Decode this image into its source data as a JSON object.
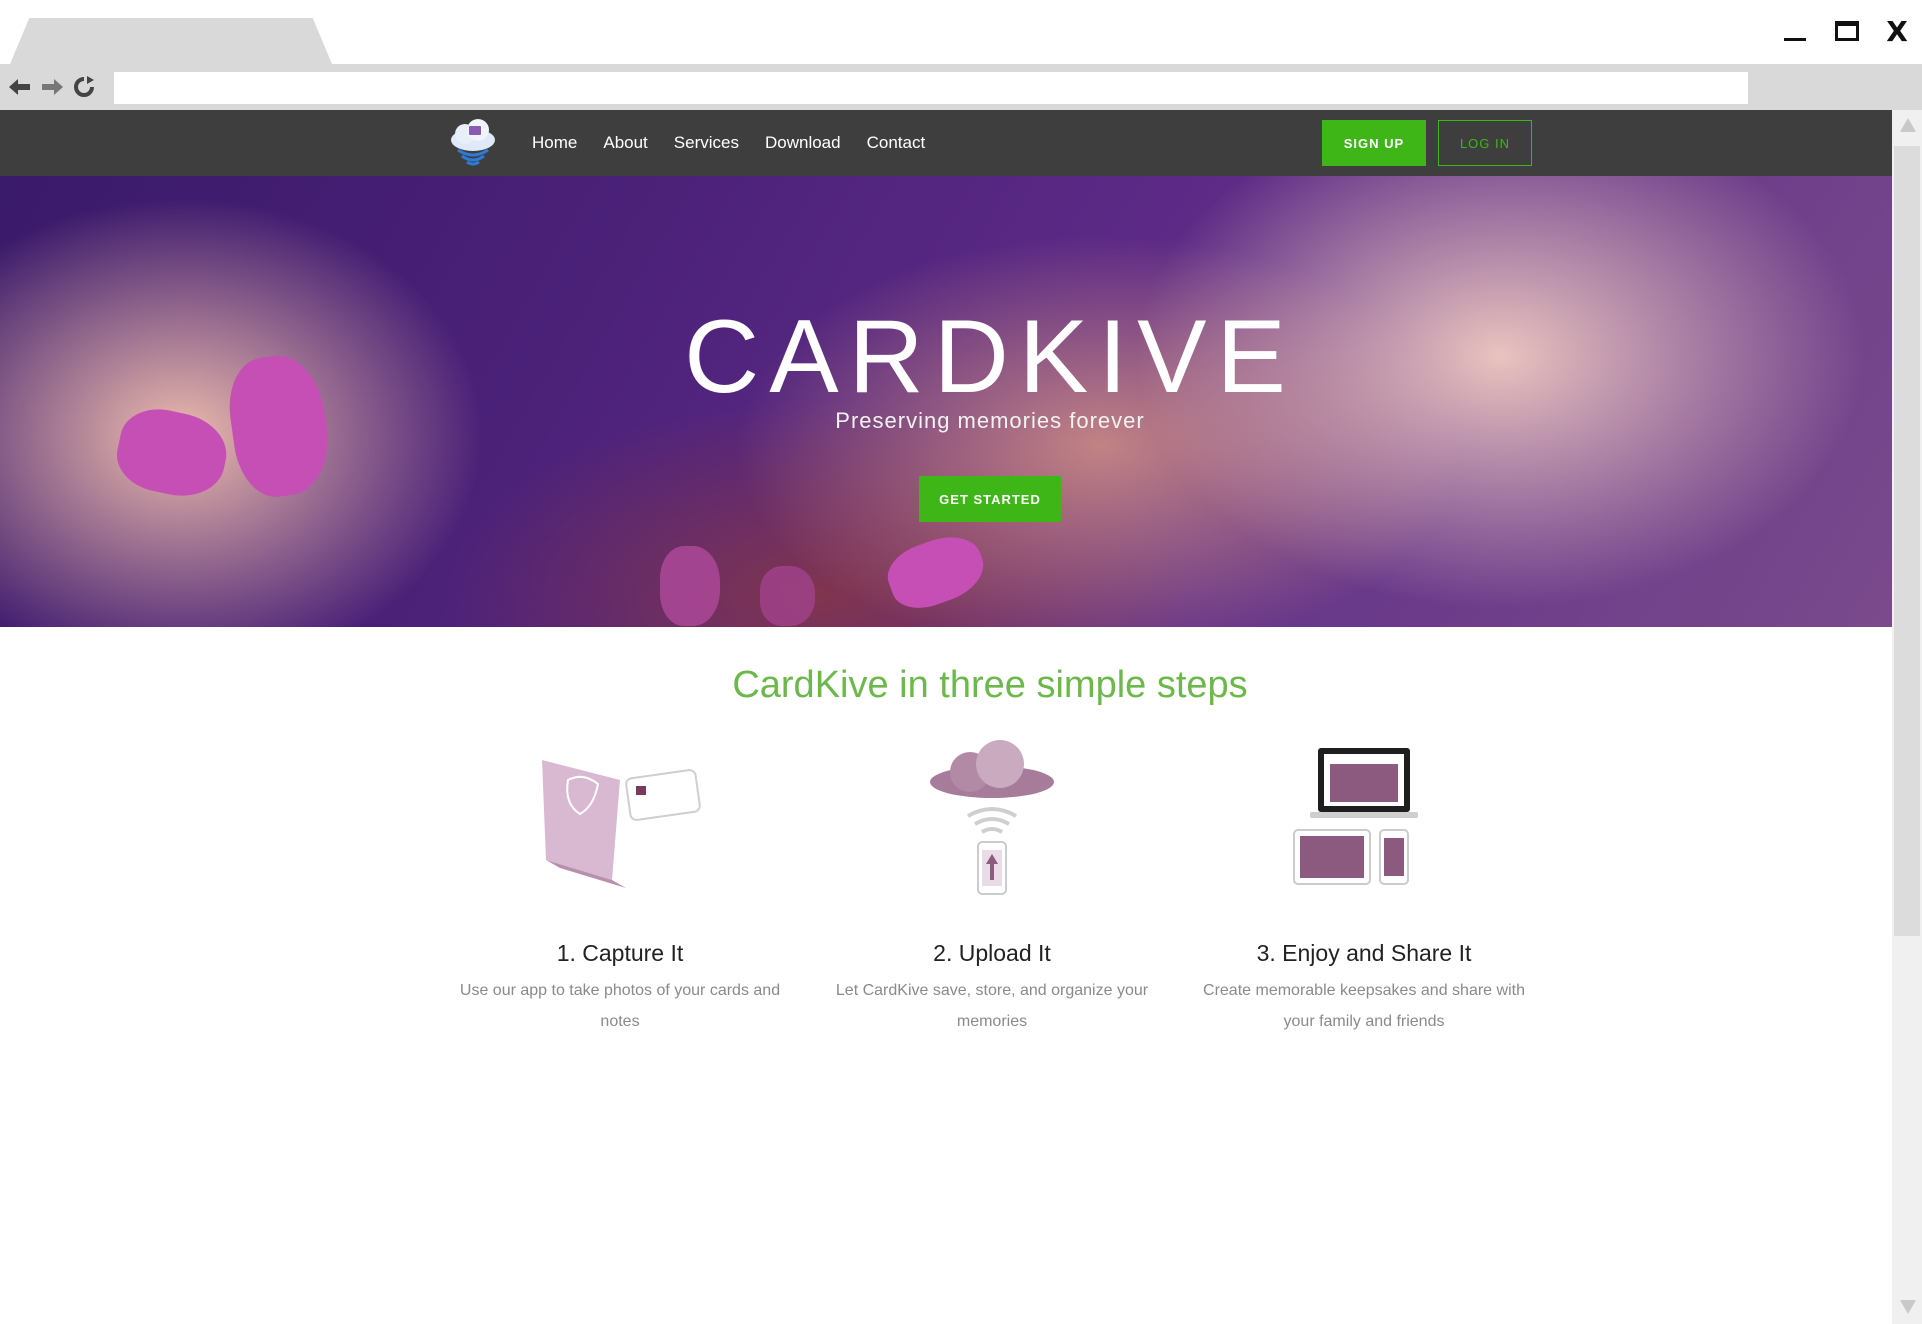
{
  "browser": {
    "address_value": "",
    "icons": [
      "back-arrow-icon",
      "forward-arrow-icon",
      "reload-icon",
      "minimize-icon",
      "maximize-icon",
      "close-icon"
    ],
    "close_glyph": "X"
  },
  "nav": {
    "links": [
      "Home",
      "About",
      "Services",
      "Download",
      "Contact"
    ],
    "signup_label": "SIGN UP",
    "login_label": "LOG IN"
  },
  "hero": {
    "title": "CARDKIVE",
    "subtitle": "Preserving memories forever",
    "cta_label": "GET STARTED"
  },
  "steps": {
    "title": "CardKive in three simple steps",
    "items": [
      {
        "title": "1. Capture It",
        "desc": "Use our app to take photos of your cards and notes"
      },
      {
        "title": "2. Upload It",
        "desc": "Let CardKive save, store, and organize your memories"
      },
      {
        "title": "3. Enjoy and Share It",
        "desc": "Create memorable keepsakes and share with your family and friends"
      }
    ]
  },
  "colors": {
    "accent_green": "#3fb618",
    "nav_bg": "#3e3e3e",
    "steps_title_green": "#6cb84a",
    "card_purple": "#8c5a7e"
  }
}
